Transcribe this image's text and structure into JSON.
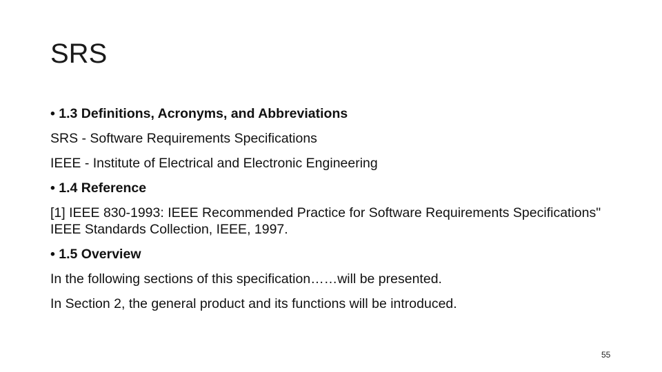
{
  "slide": {
    "title": "SRS",
    "lines": [
      {
        "text": "• 1.3 Definitions, Acronyms, and Abbreviations",
        "bold": true
      },
      {
        "text": "SRS - Software Requirements Specifications",
        "bold": false
      },
      {
        "text": "IEEE - Institute of Electrical and Electronic Engineering",
        "bold": false
      },
      {
        "text": "• 1.4 Reference",
        "bold": true
      },
      {
        "text": "[1] IEEE 830-1993: IEEE Recommended Practice for Software Requirements Specifications\" IEEE Standards Collection, IEEE, 1997.",
        "bold": false
      },
      {
        "text": "• 1.5 Overview",
        "bold": true
      },
      {
        "text": "In the following sections of this specification……will be presented.",
        "bold": false
      },
      {
        "text": "In Section 2, the general product and its functions will be introduced.",
        "bold": false
      }
    ],
    "page_number": "55"
  }
}
